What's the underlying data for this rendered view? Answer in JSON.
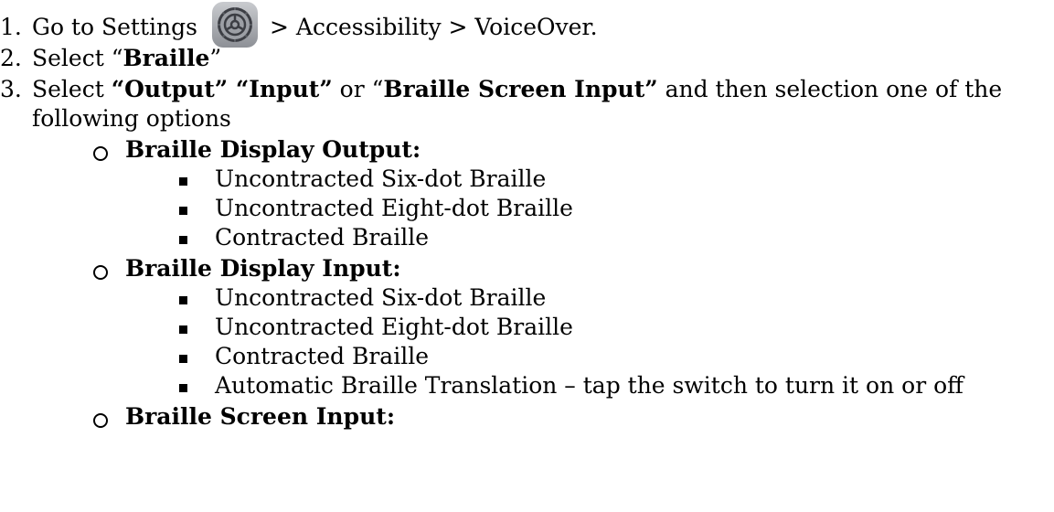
{
  "steps": [
    {
      "num": "1.",
      "parts": [
        "Go to Settings",
        "> Accessibility > VoiceOver."
      ]
    },
    {
      "num": "2.",
      "pre": "Select “",
      "bold": "Braille",
      "post": "”"
    },
    {
      "num": "3.",
      "pre": "Select ",
      "bold1": "“Output” “Input”",
      "mid": " or “",
      "bold2": "Braille Screen Input”",
      "post": " and then selection one of the",
      "cont": "following options"
    }
  ],
  "icon": "settings-gear-icon",
  "sections": [
    {
      "title": "Braille Display Output:",
      "items": [
        "Uncontracted Six-dot Braille",
        "Uncontracted Eight-dot Braille",
        "Contracted Braille"
      ]
    },
    {
      "title": "Braille Display Input:",
      "items": [
        "Uncontracted Six-dot Braille",
        "Uncontracted Eight-dot Braille",
        "Contracted Braille",
        "Automatic Braille Translation – tap the switch to turn it on or off"
      ]
    },
    {
      "title": "Braille Screen Input:",
      "items": []
    }
  ]
}
